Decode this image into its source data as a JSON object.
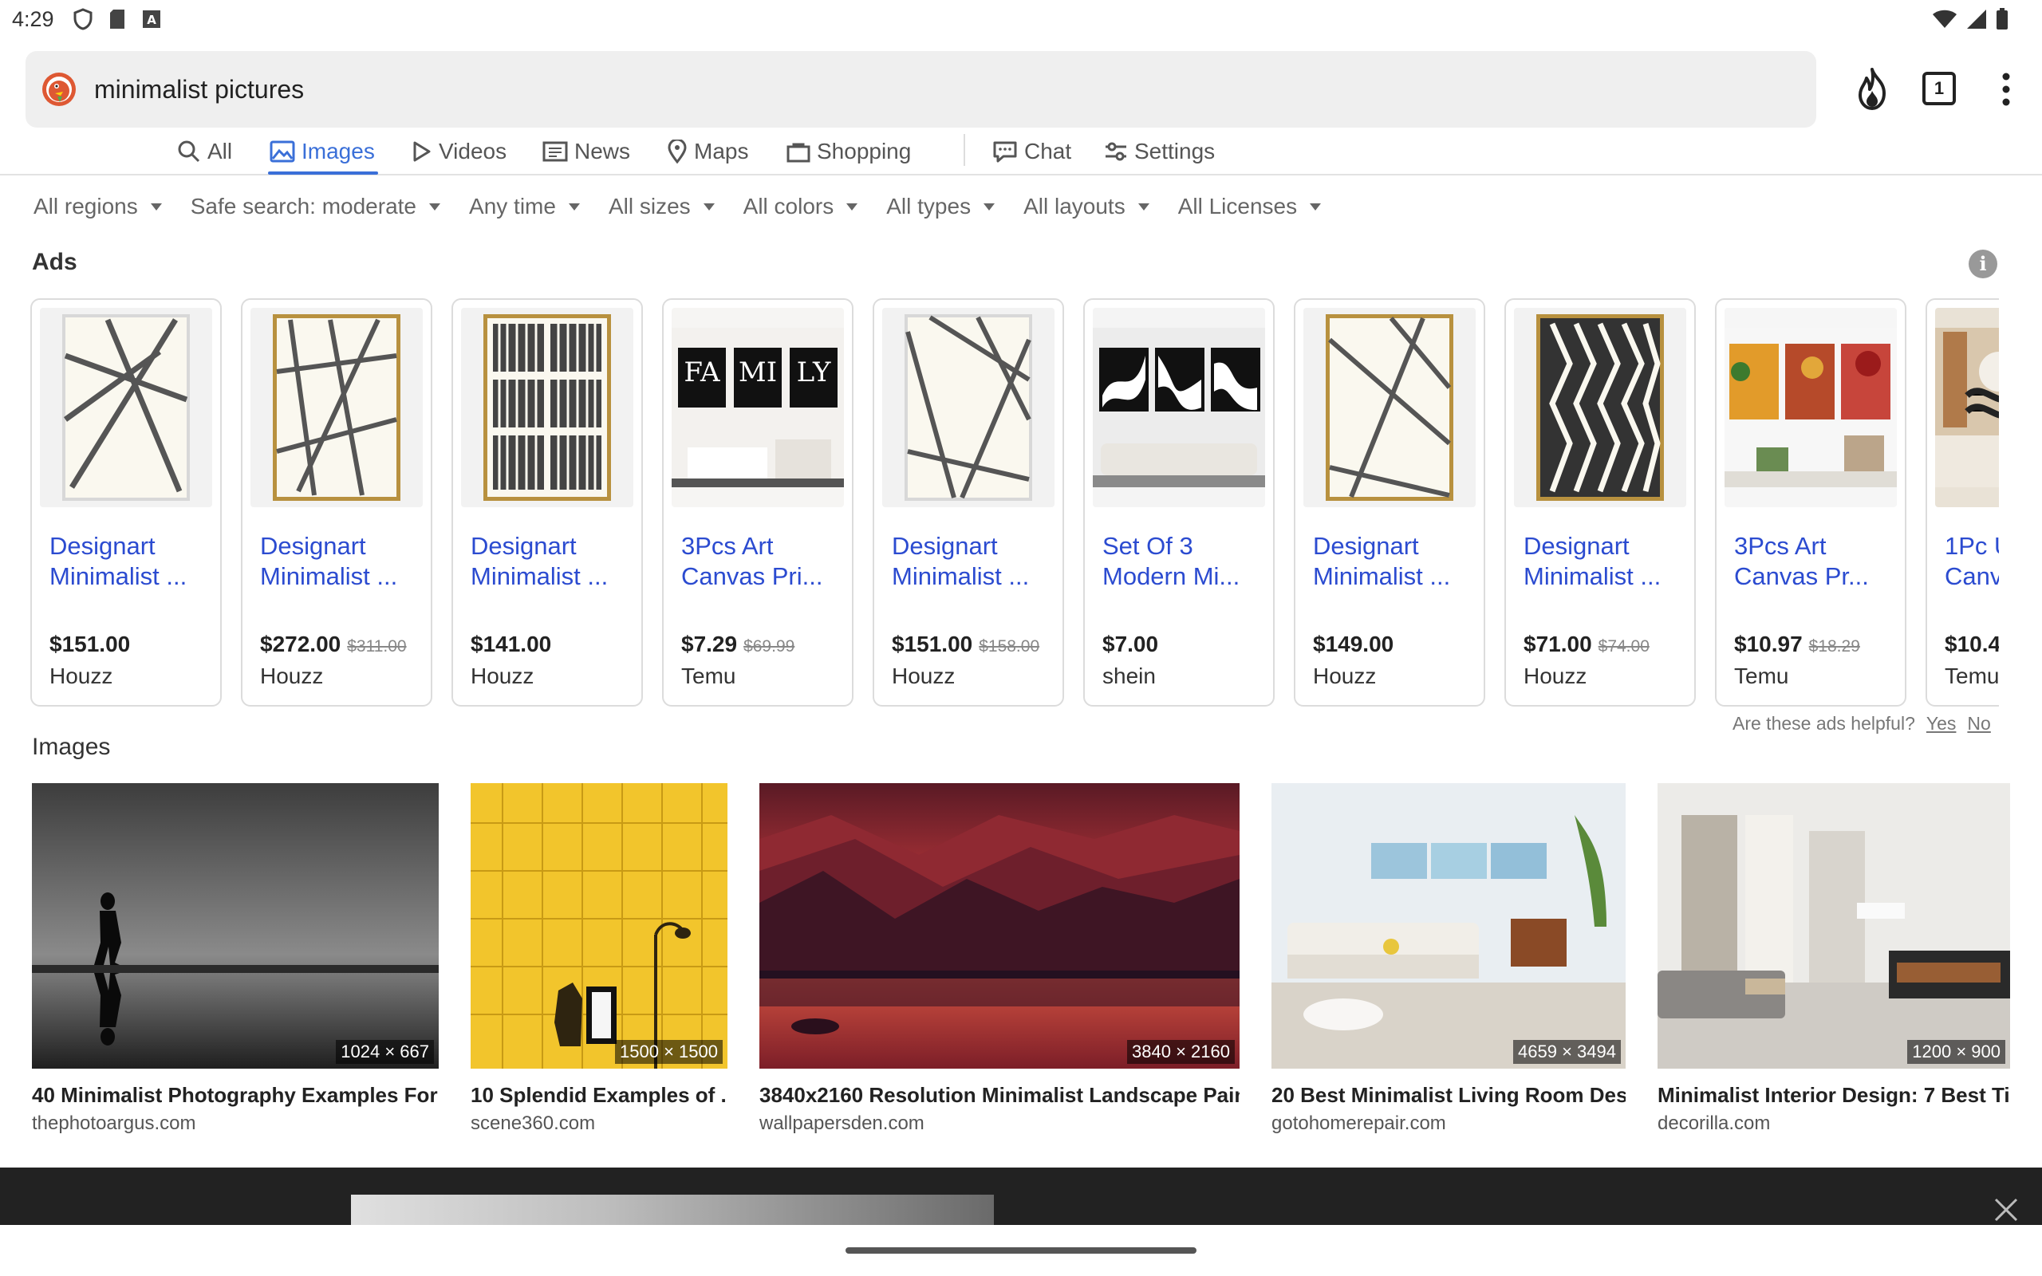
{
  "status_bar": {
    "time": "4:29"
  },
  "search": {
    "query": "minimalist pictures",
    "tab_count": "1"
  },
  "nav": {
    "tabs": [
      {
        "label": "All"
      },
      {
        "label": "Images"
      },
      {
        "label": "Videos"
      },
      {
        "label": "News"
      },
      {
        "label": "Maps"
      },
      {
        "label": "Shopping"
      },
      {
        "label": "Chat"
      },
      {
        "label": "Settings"
      }
    ],
    "active_tab": "Images"
  },
  "filters": [
    "All regions",
    "Safe search: moderate",
    "Any time",
    "All sizes",
    "All colors",
    "All types",
    "All layouts",
    "All Licenses"
  ],
  "ads": {
    "title": "Ads",
    "items": [
      {
        "title1": "Designart",
        "title2": "Minimalist ...",
        "price": "$151.00",
        "old_price": "",
        "store": "Houzz"
      },
      {
        "title1": "Designart",
        "title2": "Minimalist ...",
        "price": "$272.00",
        "old_price": "$311.00",
        "store": "Houzz"
      },
      {
        "title1": "Designart",
        "title2": "Minimalist ...",
        "price": "$141.00",
        "old_price": "",
        "store": "Houzz"
      },
      {
        "title1": "3Pcs Art",
        "title2": "Canvas Pri...",
        "price": "$7.29",
        "old_price": "$69.99",
        "store": "Temu"
      },
      {
        "title1": "Designart",
        "title2": "Minimalist ...",
        "price": "$151.00",
        "old_price": "$158.00",
        "store": "Houzz"
      },
      {
        "title1": "Set Of 3",
        "title2": "Modern Mi...",
        "price": "$7.00",
        "old_price": "",
        "store": "shein"
      },
      {
        "title1": "Designart",
        "title2": "Minimalist ...",
        "price": "$149.00",
        "old_price": "",
        "store": "Houzz"
      },
      {
        "title1": "Designart",
        "title2": "Minimalist ...",
        "price": "$71.00",
        "old_price": "$74.00",
        "store": "Houzz"
      },
      {
        "title1": "3Pcs Art",
        "title2": "Canvas Pr...",
        "price": "$10.97",
        "old_price": "$18.29",
        "store": "Temu"
      },
      {
        "title1": "1Pc U",
        "title2": "Canv",
        "price": "$10.4",
        "old_price": "",
        "store": "Temu"
      }
    ],
    "family_words": [
      "FA",
      "MI",
      "LY"
    ],
    "feedback_question": "Are these ads helpful?",
    "feedback_yes": "Yes",
    "feedback_no": "No"
  },
  "images": {
    "title": "Images",
    "items": [
      {
        "title": "40 Minimalist Photography Examples For ...",
        "source": "thephotoargus.com",
        "dimensions": "1024 × 667"
      },
      {
        "title": "10 Splendid Examples of ...",
        "source": "scene360.com",
        "dimensions": "1500 × 1500"
      },
      {
        "title": "3840x2160 Resolution Minimalist Landscape Pain...",
        "source": "wallpapersden.com",
        "dimensions": "3840 × 2160"
      },
      {
        "title": "20 Best Minimalist Living Room Des...",
        "source": "gotohomerepair.com",
        "dimensions": "4659 × 3494"
      },
      {
        "title": "Minimalist Interior Design: 7 Best Ti...",
        "source": "decorilla.com",
        "dimensions": "1200 × 900"
      }
    ]
  },
  "colors": {
    "accent": "#3a6fd8",
    "link": "#2b4bd0",
    "ddg_orange": "#de5833"
  }
}
